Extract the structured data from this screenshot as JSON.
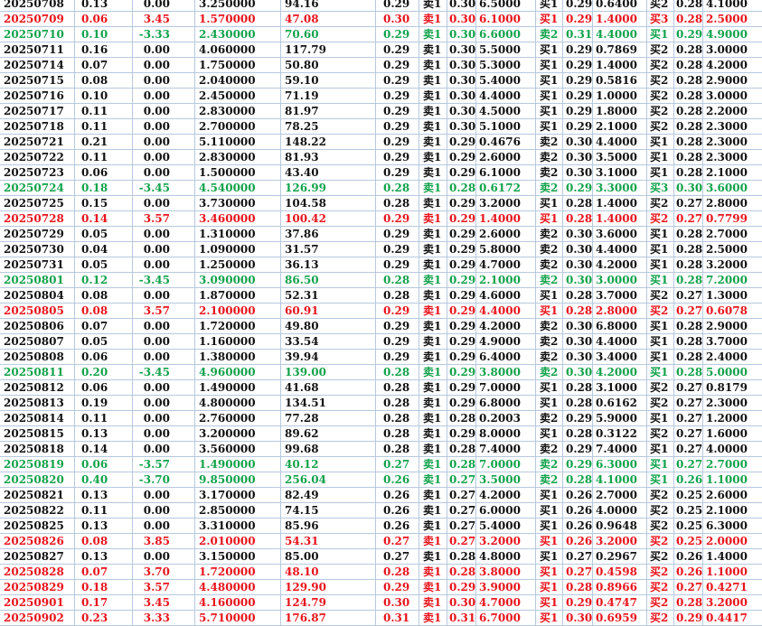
{
  "title": "",
  "columns": [
    "date",
    "change",
    "pct",
    "price",
    "amount",
    "level",
    "side_a",
    "ask_a",
    "vol_a",
    "side_b",
    "bid_b",
    "vol_b",
    "side_c",
    "bid_c",
    "vol_c"
  ],
  "colors": {
    "red": "#e8141c",
    "green": "#13a24b",
    "black": "#111111",
    "grid": "#b7c9de"
  },
  "rows": [
    {
      "color": "black",
      "cells": [
        "20250708",
        "0.13",
        "0.00",
        "3.250000",
        "94.16",
        "0.29",
        "卖1",
        "0.30",
        "6.5000",
        "买1",
        "0.29",
        "0.6400",
        "买2",
        "0.28",
        "4.1000"
      ]
    },
    {
      "color": "red",
      "cells": [
        "20250709",
        "0.06",
        "3.45",
        "1.570000",
        "47.08",
        "0.30",
        "卖1",
        "0.30",
        "6.1000",
        "买1",
        "0.29",
        "1.4000",
        "买3",
        "0.28",
        "2.5000"
      ]
    },
    {
      "color": "green",
      "cells": [
        "20250710",
        "0.10",
        "-3.33",
        "2.430000",
        "70.60",
        "0.29",
        "卖1",
        "0.30",
        "6.6000",
        "卖2",
        "0.31",
        "4.4000",
        "买1",
        "0.29",
        "4.9000"
      ]
    },
    {
      "color": "black",
      "cells": [
        "20250711",
        "0.16",
        "0.00",
        "4.060000",
        "117.79",
        "0.29",
        "卖1",
        "0.30",
        "5.5000",
        "买1",
        "0.29",
        "0.7869",
        "买2",
        "0.28",
        "3.0000"
      ]
    },
    {
      "color": "black",
      "cells": [
        "20250714",
        "0.07",
        "0.00",
        "1.750000",
        "50.80",
        "0.29",
        "卖1",
        "0.30",
        "5.3000",
        "买1",
        "0.29",
        "1.4000",
        "买2",
        "0.28",
        "4.2000"
      ]
    },
    {
      "color": "black",
      "cells": [
        "20250715",
        "0.08",
        "0.00",
        "2.040000",
        "59.10",
        "0.29",
        "卖1",
        "0.30",
        "5.4000",
        "买1",
        "0.29",
        "0.5816",
        "买2",
        "0.28",
        "2.9000"
      ]
    },
    {
      "color": "black",
      "cells": [
        "20250716",
        "0.10",
        "0.00",
        "2.450000",
        "71.19",
        "0.29",
        "卖1",
        "0.30",
        "4.4000",
        "买1",
        "0.29",
        "1.0000",
        "买2",
        "0.28",
        "3.0000"
      ]
    },
    {
      "color": "black",
      "cells": [
        "20250717",
        "0.11",
        "0.00",
        "2.830000",
        "81.97",
        "0.29",
        "卖1",
        "0.30",
        "4.5000",
        "买1",
        "0.29",
        "1.8000",
        "买2",
        "0.28",
        "2.2000"
      ]
    },
    {
      "color": "black",
      "cells": [
        "20250718",
        "0.11",
        "0.00",
        "2.700000",
        "78.25",
        "0.29",
        "卖1",
        "0.30",
        "5.1000",
        "买1",
        "0.29",
        "2.1000",
        "买2",
        "0.28",
        "2.3000"
      ]
    },
    {
      "color": "black",
      "cells": [
        "20250721",
        "0.21",
        "0.00",
        "5.110000",
        "148.22",
        "0.29",
        "卖1",
        "0.29",
        "0.4676",
        "卖2",
        "0.30",
        "4.4000",
        "买1",
        "0.28",
        "2.3000"
      ]
    },
    {
      "color": "black",
      "cells": [
        "20250722",
        "0.11",
        "0.00",
        "2.830000",
        "81.93",
        "0.29",
        "卖1",
        "0.29",
        "2.6000",
        "卖2",
        "0.30",
        "3.5000",
        "买1",
        "0.28",
        "2.3000"
      ]
    },
    {
      "color": "black",
      "cells": [
        "20250723",
        "0.06",
        "0.00",
        "1.500000",
        "43.40",
        "0.29",
        "卖1",
        "0.29",
        "6.1000",
        "卖2",
        "0.30",
        "3.1000",
        "买1",
        "0.28",
        "2.1000"
      ]
    },
    {
      "color": "green",
      "cells": [
        "20250724",
        "0.18",
        "-3.45",
        "4.540000",
        "126.99",
        "0.28",
        "卖1",
        "0.28",
        "0.6172",
        "卖2",
        "0.29",
        "3.3000",
        "买3",
        "0.30",
        "3.6000"
      ]
    },
    {
      "color": "black",
      "cells": [
        "20250725",
        "0.15",
        "0.00",
        "3.730000",
        "104.58",
        "0.28",
        "卖1",
        "0.29",
        "3.2000",
        "买1",
        "0.28",
        "1.4000",
        "买2",
        "0.27",
        "2.8000"
      ]
    },
    {
      "color": "red",
      "cells": [
        "20250728",
        "0.14",
        "3.57",
        "3.460000",
        "100.42",
        "0.29",
        "卖1",
        "0.29",
        "1.4000",
        "买1",
        "0.28",
        "1.4000",
        "买2",
        "0.27",
        "0.7799"
      ]
    },
    {
      "color": "black",
      "cells": [
        "20250729",
        "0.05",
        "0.00",
        "1.310000",
        "37.86",
        "0.29",
        "卖1",
        "0.29",
        "2.6000",
        "卖2",
        "0.30",
        "3.6000",
        "买1",
        "0.28",
        "2.7000"
      ]
    },
    {
      "color": "black",
      "cells": [
        "20250730",
        "0.04",
        "0.00",
        "1.090000",
        "31.57",
        "0.29",
        "卖1",
        "0.29",
        "5.8000",
        "卖2",
        "0.30",
        "4.4000",
        "买1",
        "0.28",
        "2.5000"
      ]
    },
    {
      "color": "black",
      "cells": [
        "20250731",
        "0.05",
        "0.00",
        "1.250000",
        "36.13",
        "0.29",
        "卖1",
        "0.29",
        "4.7000",
        "卖2",
        "0.30",
        "4.2000",
        "买1",
        "0.28",
        "3.2000"
      ]
    },
    {
      "color": "green",
      "cells": [
        "20250801",
        "0.12",
        "-3.45",
        "3.090000",
        "86.50",
        "0.28",
        "卖1",
        "0.29",
        "2.1000",
        "卖2",
        "0.30",
        "3.0000",
        "买1",
        "0.28",
        "7.2000"
      ]
    },
    {
      "color": "black",
      "cells": [
        "20250804",
        "0.08",
        "0.00",
        "1.870000",
        "52.31",
        "0.28",
        "卖1",
        "0.29",
        "4.6000",
        "买1",
        "0.28",
        "3.7000",
        "买2",
        "0.27",
        "1.3000"
      ]
    },
    {
      "color": "red",
      "cells": [
        "20250805",
        "0.08",
        "3.57",
        "2.100000",
        "60.91",
        "0.29",
        "卖1",
        "0.29",
        "4.4000",
        "买1",
        "0.28",
        "2.8000",
        "买2",
        "0.27",
        "0.6078"
      ]
    },
    {
      "color": "black",
      "cells": [
        "20250806",
        "0.07",
        "0.00",
        "1.720000",
        "49.80",
        "0.29",
        "卖1",
        "0.29",
        "4.2000",
        "卖2",
        "0.30",
        "6.8000",
        "买1",
        "0.28",
        "2.9000"
      ]
    },
    {
      "color": "black",
      "cells": [
        "20250807",
        "0.05",
        "0.00",
        "1.160000",
        "33.54",
        "0.29",
        "卖1",
        "0.29",
        "4.9000",
        "卖2",
        "0.30",
        "4.4000",
        "买1",
        "0.28",
        "3.7000"
      ]
    },
    {
      "color": "black",
      "cells": [
        "20250808",
        "0.06",
        "0.00",
        "1.380000",
        "39.94",
        "0.29",
        "卖1",
        "0.29",
        "6.4000",
        "卖2",
        "0.30",
        "3.4000",
        "买1",
        "0.28",
        "2.4000"
      ]
    },
    {
      "color": "green",
      "cells": [
        "20250811",
        "0.20",
        "-3.45",
        "4.960000",
        "139.00",
        "0.28",
        "卖1",
        "0.29",
        "3.8000",
        "卖2",
        "0.30",
        "4.2000",
        "买1",
        "0.28",
        "5.0000"
      ]
    },
    {
      "color": "black",
      "cells": [
        "20250812",
        "0.06",
        "0.00",
        "1.490000",
        "41.68",
        "0.28",
        "卖1",
        "0.29",
        "7.0000",
        "买1",
        "0.28",
        "3.1000",
        "买2",
        "0.27",
        "0.8179"
      ]
    },
    {
      "color": "black",
      "cells": [
        "20250813",
        "0.19",
        "0.00",
        "4.800000",
        "134.51",
        "0.28",
        "卖1",
        "0.29",
        "6.8000",
        "买1",
        "0.28",
        "0.6162",
        "买2",
        "0.27",
        "2.3000"
      ]
    },
    {
      "color": "black",
      "cells": [
        "20250814",
        "0.11",
        "0.00",
        "2.760000",
        "77.28",
        "0.28",
        "卖1",
        "0.28",
        "0.2003",
        "卖2",
        "0.29",
        "5.9000",
        "买1",
        "0.27",
        "1.2000"
      ]
    },
    {
      "color": "black",
      "cells": [
        "20250815",
        "0.13",
        "0.00",
        "3.200000",
        "89.62",
        "0.28",
        "卖1",
        "0.29",
        "8.0000",
        "买1",
        "0.28",
        "0.3122",
        "买2",
        "0.27",
        "1.6000"
      ]
    },
    {
      "color": "black",
      "cells": [
        "20250818",
        "0.14",
        "0.00",
        "3.560000",
        "99.68",
        "0.28",
        "卖1",
        "0.28",
        "7.4000",
        "卖2",
        "0.29",
        "7.4000",
        "买1",
        "0.27",
        "4.0000"
      ]
    },
    {
      "color": "green",
      "cells": [
        "20250819",
        "0.06",
        "-3.57",
        "1.490000",
        "40.12",
        "0.27",
        "卖1",
        "0.28",
        "7.0000",
        "卖2",
        "0.29",
        "6.3000",
        "买1",
        "0.27",
        "2.7000"
      ]
    },
    {
      "color": "green",
      "cells": [
        "20250820",
        "0.40",
        "-3.70",
        "9.850000",
        "256.04",
        "0.26",
        "卖1",
        "0.27",
        "3.5000",
        "卖2",
        "0.28",
        "4.1000",
        "买1",
        "0.26",
        "1.1000"
      ]
    },
    {
      "color": "black",
      "cells": [
        "20250821",
        "0.13",
        "0.00",
        "3.170000",
        "82.49",
        "0.26",
        "卖1",
        "0.27",
        "4.2000",
        "买1",
        "0.26",
        "2.7000",
        "买2",
        "0.25",
        "2.6000"
      ]
    },
    {
      "color": "black",
      "cells": [
        "20250822",
        "0.11",
        "0.00",
        "2.850000",
        "74.15",
        "0.26",
        "卖1",
        "0.27",
        "6.0000",
        "买1",
        "0.26",
        "4.0000",
        "买2",
        "0.25",
        "2.1000"
      ]
    },
    {
      "color": "black",
      "cells": [
        "20250825",
        "0.13",
        "0.00",
        "3.310000",
        "85.96",
        "0.26",
        "卖1",
        "0.27",
        "5.4000",
        "买1",
        "0.26",
        "0.9648",
        "买2",
        "0.25",
        "6.3000"
      ]
    },
    {
      "color": "red",
      "cells": [
        "20250826",
        "0.08",
        "3.85",
        "2.010000",
        "54.31",
        "0.27",
        "卖1",
        "0.27",
        "3.2000",
        "买1",
        "0.26",
        "3.2000",
        "买2",
        "0.25",
        "2.0000"
      ]
    },
    {
      "color": "black",
      "cells": [
        "20250827",
        "0.13",
        "0.00",
        "3.150000",
        "85.00",
        "0.27",
        "卖1",
        "0.28",
        "4.8000",
        "买1",
        "0.27",
        "0.2967",
        "买2",
        "0.26",
        "1.4000"
      ]
    },
    {
      "color": "red",
      "cells": [
        "20250828",
        "0.07",
        "3.70",
        "1.720000",
        "48.10",
        "0.28",
        "卖1",
        "0.28",
        "3.8000",
        "买1",
        "0.27",
        "0.4598",
        "买2",
        "0.26",
        "1.1000"
      ]
    },
    {
      "color": "red",
      "cells": [
        "20250829",
        "0.18",
        "3.57",
        "4.480000",
        "129.90",
        "0.29",
        "卖1",
        "0.29",
        "3.9000",
        "买1",
        "0.28",
        "0.8966",
        "买2",
        "0.27",
        "0.4271"
      ]
    },
    {
      "color": "red",
      "cells": [
        "20250901",
        "0.17",
        "3.45",
        "4.160000",
        "124.79",
        "0.30",
        "卖1",
        "0.30",
        "4.7000",
        "买1",
        "0.29",
        "0.4747",
        "买2",
        "0.28",
        "3.2000"
      ]
    },
    {
      "color": "red",
      "cells": [
        "20250902",
        "0.23",
        "3.33",
        "5.710000",
        "176.87",
        "0.31",
        "卖1",
        "0.31",
        "6.7000",
        "买1",
        "0.30",
        "0.6959",
        "买2",
        "0.29",
        "0.4417"
      ]
    }
  ]
}
